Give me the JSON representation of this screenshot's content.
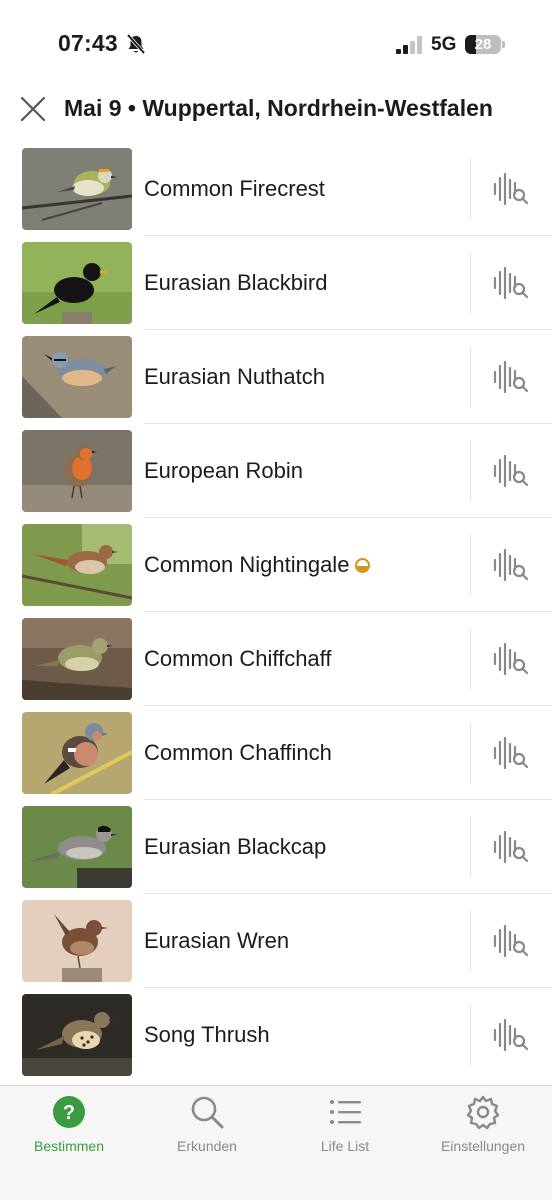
{
  "status": {
    "time": "07:43",
    "network": "5G",
    "battery": "28"
  },
  "header": {
    "title": "Mai 9 • Wuppertal, Nordrhein-Westfalen"
  },
  "species": [
    {
      "name": "Common Firecrest"
    },
    {
      "name": "Eurasian Blackbird"
    },
    {
      "name": "Eurasian Nuthatch"
    },
    {
      "name": "European Robin"
    },
    {
      "name": "Common Nightingale",
      "rare": true
    },
    {
      "name": "Common Chiffchaff"
    },
    {
      "name": "Common Chaffinch"
    },
    {
      "name": "Eurasian Blackcap"
    },
    {
      "name": "Eurasian Wren"
    },
    {
      "name": "Song Thrush"
    }
  ],
  "tabs": [
    {
      "label": "Bestimmen",
      "icon": "question-circle-icon",
      "active": true
    },
    {
      "label": "Erkunden",
      "icon": "search-icon"
    },
    {
      "label": "Life List",
      "icon": "list-icon"
    },
    {
      "label": "Einstellungen",
      "icon": "gear-icon"
    }
  ],
  "colors": {
    "accent": "#3a9b43",
    "rare": "#d1951c",
    "icon_gray": "#8a8a8a"
  }
}
